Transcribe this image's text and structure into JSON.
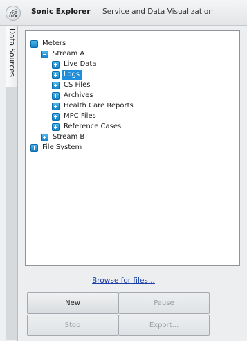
{
  "window": {
    "app_name": "Sonic Explorer",
    "subtitle": "Service and Data Visualization"
  },
  "side_tab": {
    "label": "Data Sources"
  },
  "tree": {
    "meters": "Meters",
    "stream_a": "Stream A",
    "live_data": "Live Data",
    "logs": "Logs",
    "cs_files": "CS Files",
    "archives": "Archives",
    "health_care_reports": "Health Care Reports",
    "mpc_files": "MPC Files",
    "reference_cases": "Reference Cases",
    "stream_b": "Stream B",
    "file_system": "File System",
    "selected": "Logs"
  },
  "browse_link": "Browse for files...",
  "buttons": {
    "new": "New",
    "pause": "Pause",
    "stop": "Stop",
    "export": "Export..."
  },
  "colors": {
    "expander_blue": "#1e8fdc",
    "selection": "#1e8fdc",
    "link": "#1b3ea8"
  }
}
